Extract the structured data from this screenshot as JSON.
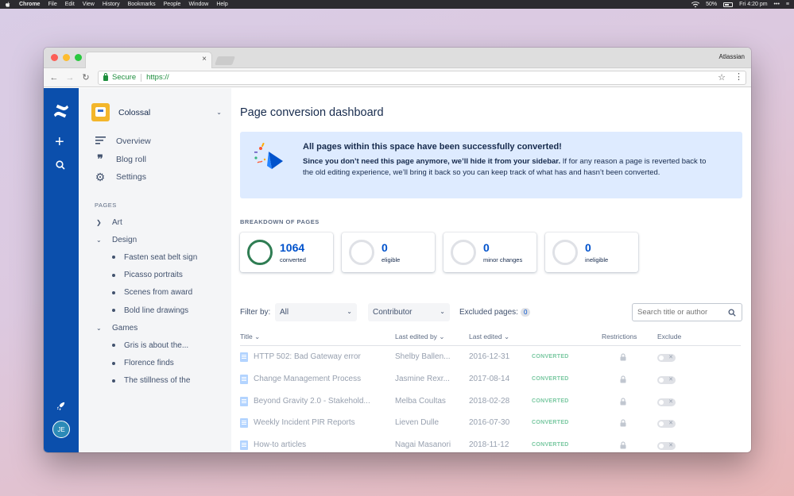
{
  "menubar": {
    "app": "Chrome",
    "items": [
      "File",
      "Edit",
      "View",
      "History",
      "Bookmarks",
      "People",
      "Window",
      "Help"
    ],
    "battery": "50%",
    "clock": "Fri 4:20 pm"
  },
  "browser": {
    "profile": "Atlassian",
    "tab_close": "×",
    "secure_label": "Secure",
    "url": "https://"
  },
  "global_nav": {
    "avatar_initials": "JE",
    "plus": "+"
  },
  "sidebar": {
    "space_name": "Colossal",
    "nav": [
      {
        "label": "Overview",
        "icon": "overview-icon"
      },
      {
        "label": "Blog roll",
        "icon": "quote-icon"
      },
      {
        "label": "Settings",
        "icon": "gear-icon"
      }
    ],
    "pages_title": "PAGES",
    "tree": [
      {
        "label": "Art",
        "level": 0,
        "expanded": false
      },
      {
        "label": "Design",
        "level": 0,
        "expanded": true
      },
      {
        "label": "Fasten seat belt sign",
        "level": 1
      },
      {
        "label": "Picasso portraits",
        "level": 1
      },
      {
        "label": "Scenes from award",
        "level": 1
      },
      {
        "label": "Bold line drawings",
        "level": 1
      },
      {
        "label": "Games",
        "level": 0,
        "expanded": true
      },
      {
        "label": "Gris is about the...",
        "level": 1
      },
      {
        "label": "Florence finds",
        "level": 1
      },
      {
        "label": "The stillness of the",
        "level": 1
      }
    ]
  },
  "main": {
    "title": "Page conversion dashboard",
    "banner": {
      "title": "All pages within this space have been successfully converted!",
      "body_bold": "Since you don’t need this page anymore, we’ll hide it from your sidebar.",
      "body_rest": " If for any reason a page is reverted back to the old editing experience, we’ll bring it back so you can keep track of what has and hasn’t been converted."
    },
    "breakdown_title": "BREAKDOWN OF PAGES",
    "cards": [
      {
        "value": "1064",
        "label": "converted",
        "ring": "green"
      },
      {
        "value": "0",
        "label": "eligible",
        "ring": "grey"
      },
      {
        "value": "0",
        "label": "minor changes",
        "ring": "grey"
      },
      {
        "value": "0",
        "label": "ineligible",
        "ring": "grey"
      }
    ],
    "filters": {
      "label": "Filter by:",
      "select_all": "All",
      "select_contributor": "Contributor",
      "excluded_label": "Excluded pages:",
      "excluded_count": "0",
      "search_placeholder": "Search title or author"
    },
    "table": {
      "headers": {
        "title": "Title",
        "last_edited_by": "Last edited by",
        "last_edited": "Last edited",
        "restrictions": "Restrictions",
        "exclude": "Exclude"
      },
      "rows": [
        {
          "title": "HTTP 502: Bad Gateway error",
          "editor": "Shelby Ballen...",
          "date": "2016-12-31",
          "status": "CONVERTED"
        },
        {
          "title": "Change Management Process",
          "editor": "Jasmine Rexr...",
          "date": "2017-08-14",
          "status": "CONVERTED"
        },
        {
          "title": "Beyond Gravity 2.0 - Stakehold...",
          "editor": "Melba Coultas",
          "date": "2018-02-28",
          "status": "CONVERTED"
        },
        {
          "title": "Weekly Incident PIR Reports",
          "editor": "Lieven Dulle",
          "date": "2016-07-30",
          "status": "CONVERTED"
        },
        {
          "title": "How-to articles",
          "editor": "Nagai Masanori",
          "date": "2018-11-12",
          "status": "CONVERTED"
        }
      ]
    }
  },
  "colors": {
    "global_nav": "#0b4fac",
    "banner_bg": "#deebff",
    "converted_ring": "#2f7d53",
    "status_converted": "#79c8a1",
    "link_blue": "#0052cc"
  }
}
